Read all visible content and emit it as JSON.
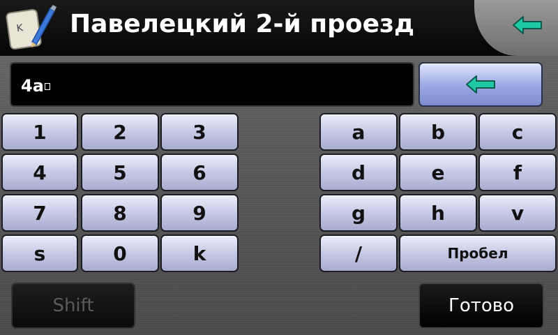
{
  "header": {
    "title": "Павелецкий 2-й проезд",
    "app_icon": "keyboard-pen-icon",
    "back_icon": "arrow-left-icon"
  },
  "input": {
    "value": "4а"
  },
  "backspace": {
    "icon": "arrow-left-icon"
  },
  "numpad": [
    "1",
    "2",
    "3",
    "4",
    "5",
    "6",
    "7",
    "8",
    "9",
    "s",
    "0",
    "k"
  ],
  "letters": [
    "a",
    "b",
    "c",
    "d",
    "e",
    "f",
    "g",
    "h",
    "v",
    "/"
  ],
  "space_label": "Пробел",
  "shift_label": "Shift",
  "done_label": "Готово",
  "colors": {
    "arrow_fill": "#1fc9a6",
    "key_top": "#eceefa",
    "key_bottom": "#a8acd0",
    "backspace_top": "#dde4ff",
    "backspace_bottom": "#7f8bd0"
  }
}
